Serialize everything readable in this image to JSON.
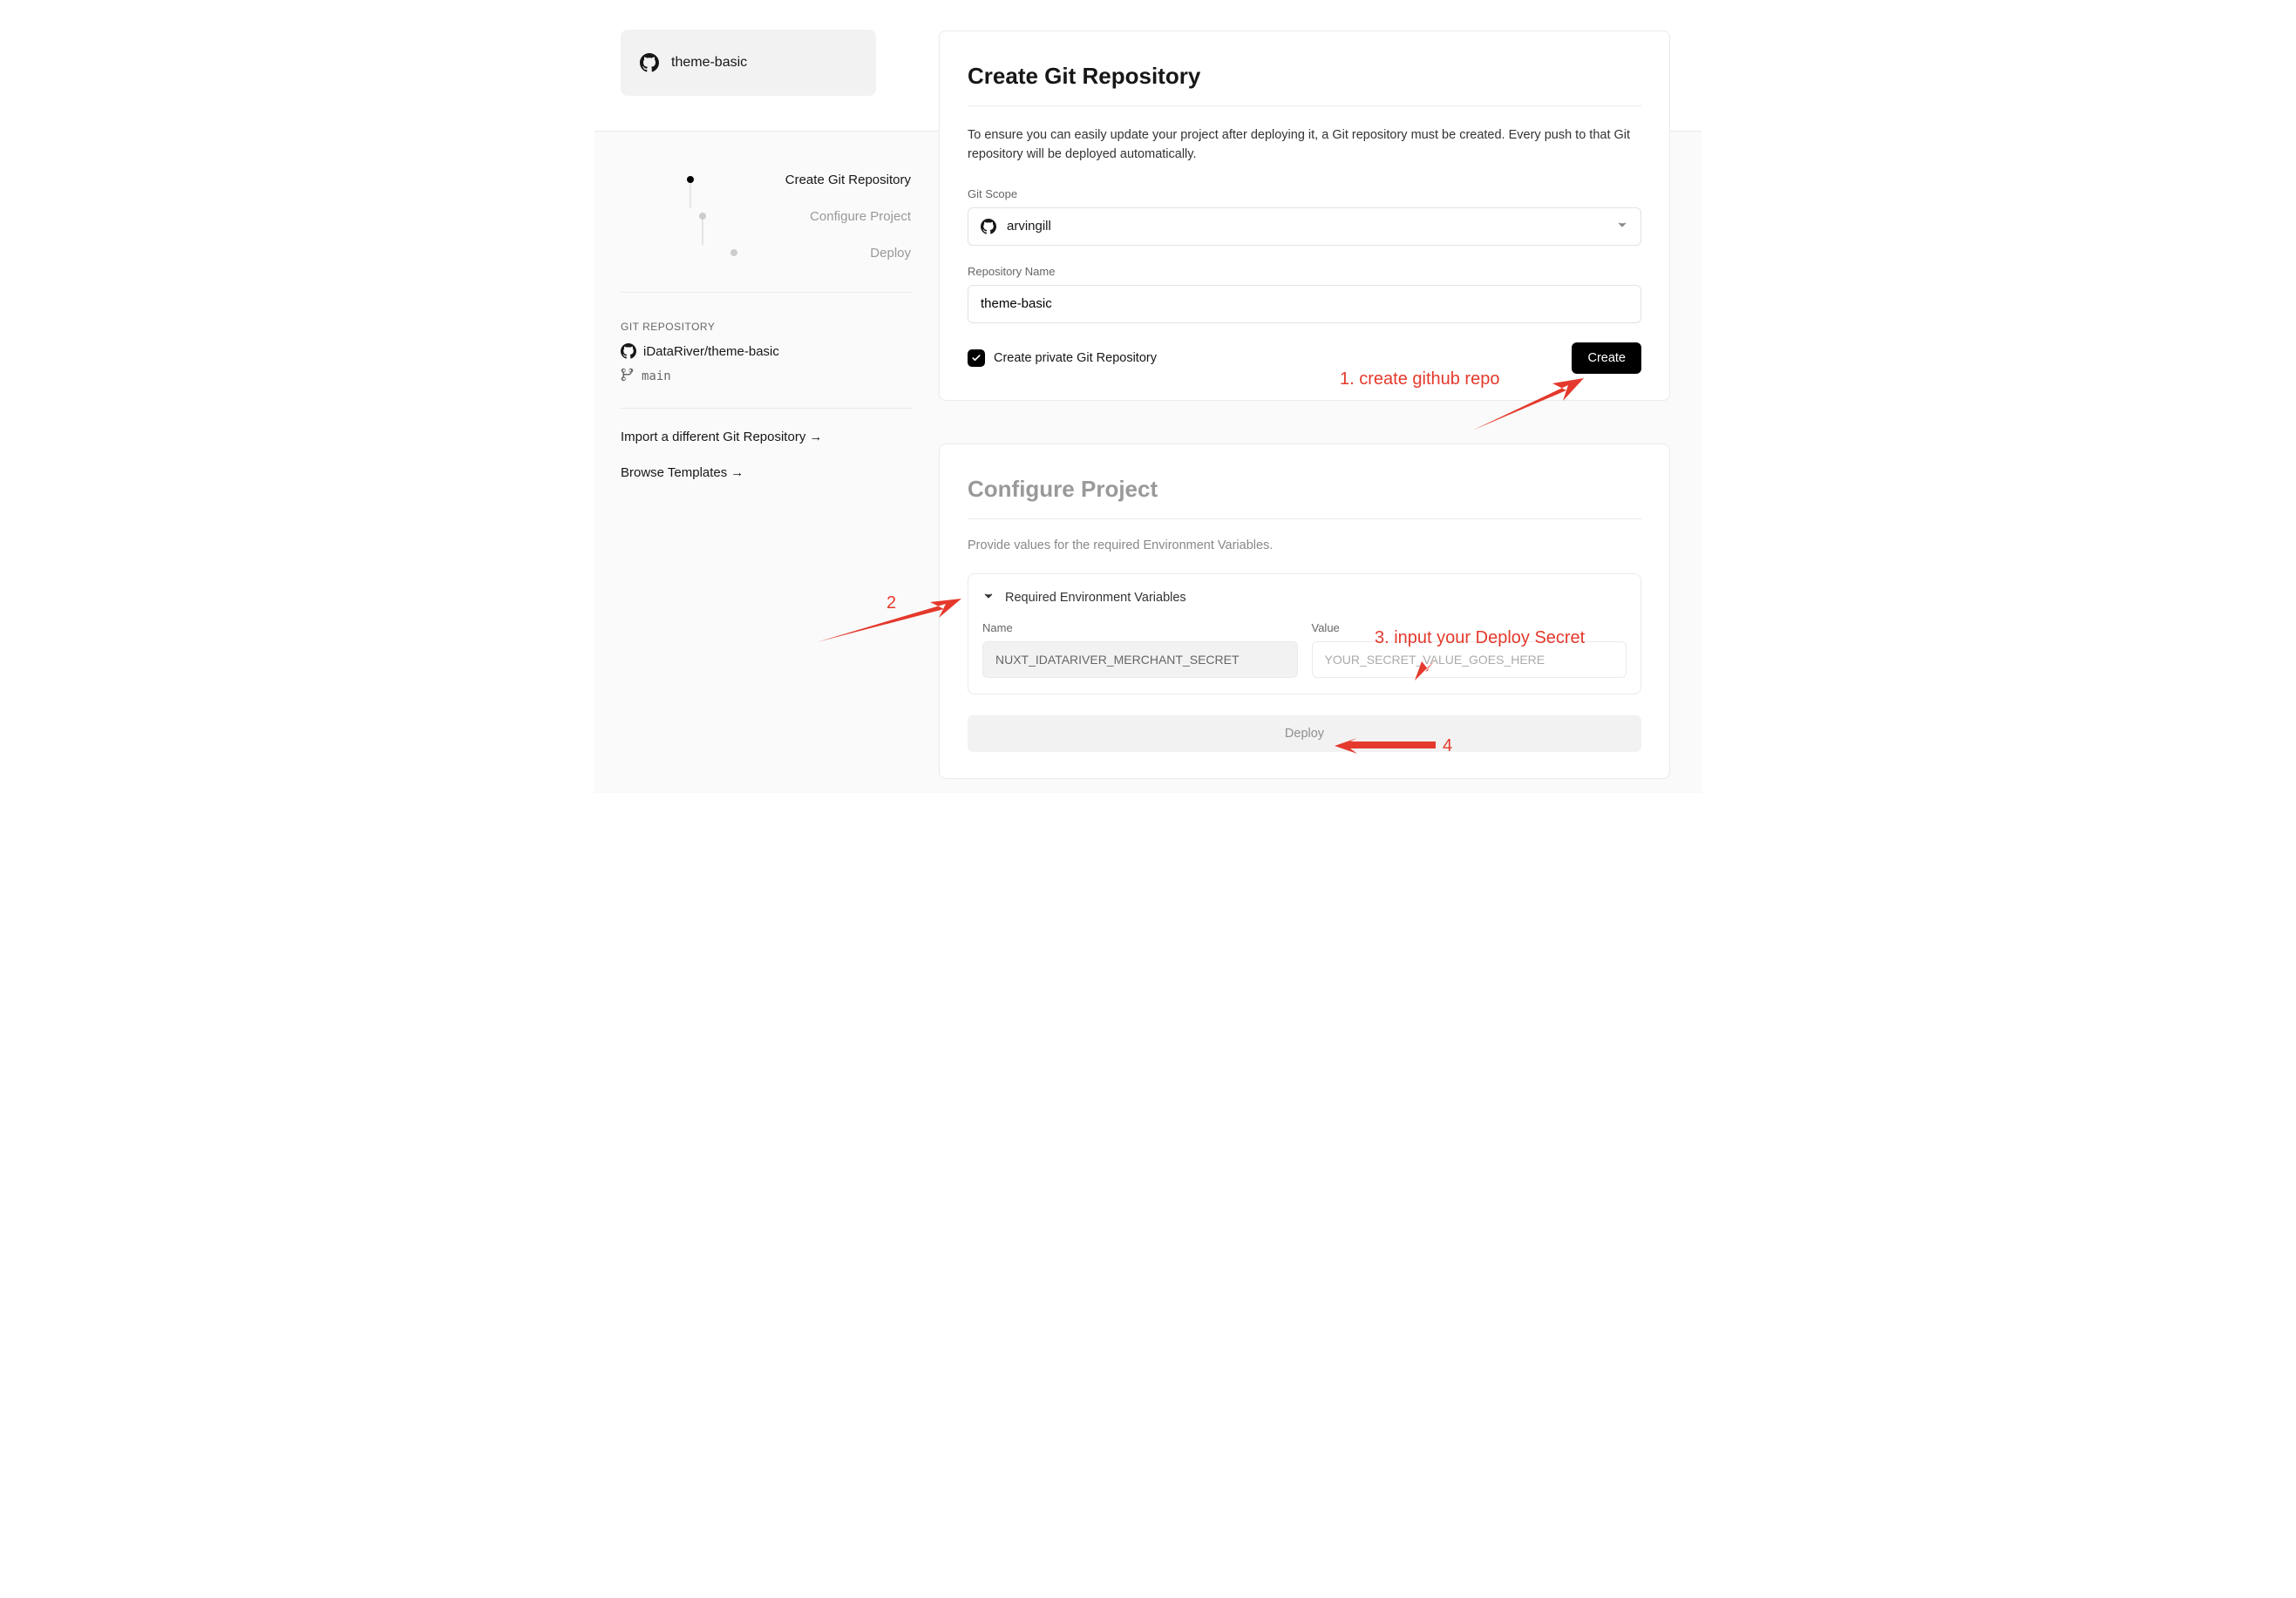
{
  "header": {
    "project_name": "theme-basic"
  },
  "sidebar": {
    "steps": [
      "Create Git Repository",
      "Configure Project",
      "Deploy"
    ],
    "section_label": "GIT REPOSITORY",
    "repo_full": "iDataRiver/theme-basic",
    "branch": "main",
    "link_import": "Import a different Git Repository",
    "link_browse": "Browse Templates",
    "arrow": "→"
  },
  "card1": {
    "title": "Create Git Repository",
    "desc": "To ensure you can easily update your project after deploying it, a Git repository must be created. Every push to that Git repository will be deployed automatically.",
    "scope_label": "Git Scope",
    "scope_value": "arvingill",
    "repo_label": "Repository Name",
    "repo_value": "theme-basic",
    "private_label": "Create private Git Repository",
    "create_btn": "Create"
  },
  "card2": {
    "title": "Configure Project",
    "desc": "Provide values for the required Environment Variables.",
    "env_header": "Required Environment Variables",
    "col_name": "Name",
    "col_value": "Value",
    "env_name_val": "NUXT_IDATARIVER_MERCHANT_SECRET",
    "env_value_placeholder": "YOUR_SECRET_VALUE_GOES_HERE",
    "deploy_btn": "Deploy"
  },
  "annotations": {
    "a1": "1. create github repo",
    "a2": "2",
    "a3": "3. input your Deploy Secret",
    "a4": "4"
  }
}
